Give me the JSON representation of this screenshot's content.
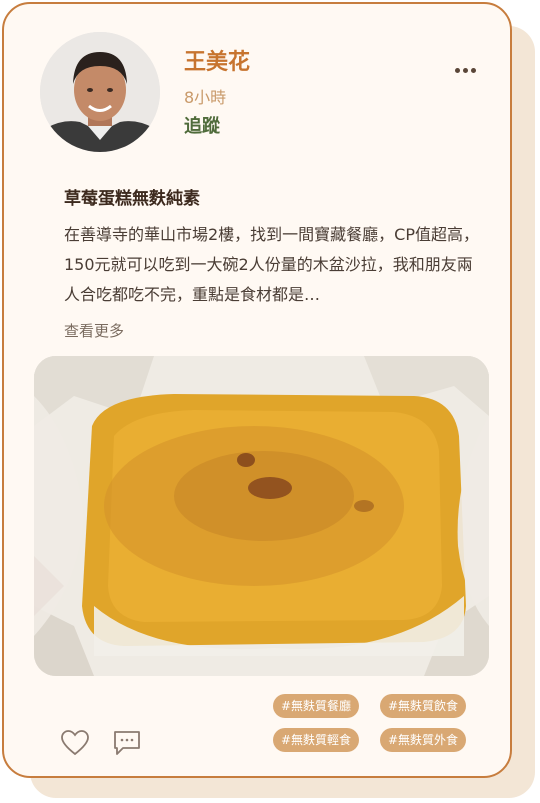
{
  "author": {
    "name": "王美花",
    "time": "8小時",
    "follow_label": "追蹤"
  },
  "post": {
    "title": "草莓蛋糕無麩純素",
    "body": "在善導寺的華山市場2樓，找到一間寶藏餐廳，CP值超高，150元就可以吃到一大碗2人份量的木盆沙拉，我和朋友兩人合吃都吃不完，重點是食材都是…",
    "see_more_label": "查看更多"
  },
  "tags": [
    "#無麩質餐廳",
    "#無麩質飲食",
    "#無麩質輕食",
    "#無麩質外食"
  ],
  "icons": {
    "more": "more-horizontal-icon",
    "like": "heart-icon",
    "comment": "comment-icon"
  },
  "colors": {
    "accent": "#c7742f",
    "follow": "#4f6b3a",
    "tag_bg": "#d9a873",
    "card_border": "#c77d3e",
    "card_bg": "#fff9f3"
  }
}
